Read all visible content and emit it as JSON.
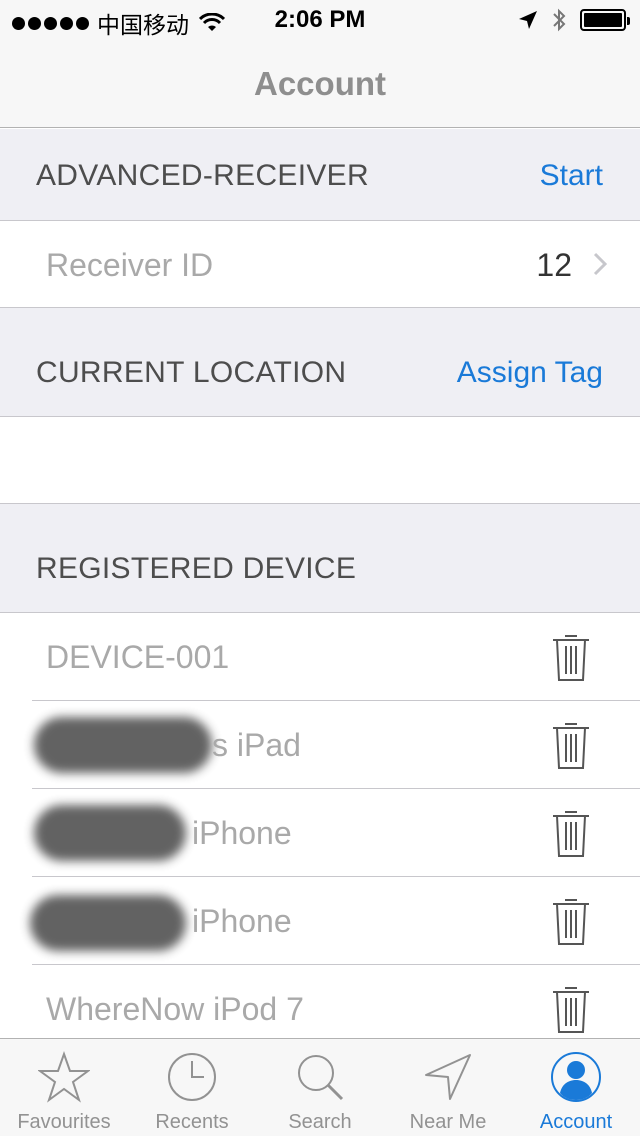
{
  "status_bar": {
    "carrier": "中国移动",
    "time": "2:06 PM"
  },
  "nav": {
    "title": "Account"
  },
  "sections": {
    "advanced_receiver": {
      "title": "ADVANCED-RECEIVER",
      "action": "Start"
    },
    "receiver_id": {
      "label": "Receiver ID",
      "value": "12"
    },
    "current_location": {
      "title": "CURRENT LOCATION",
      "action": "Assign Tag"
    },
    "registered_device": {
      "title": "REGISTERED DEVICE"
    }
  },
  "devices": [
    {
      "name": "DEVICE-001",
      "redacted": false
    },
    {
      "name": "s iPad",
      "redacted": true
    },
    {
      "name": "iPhone",
      "redacted": true
    },
    {
      "name": "iPhone",
      "redacted": true
    },
    {
      "name": "WhereNow iPod 7",
      "redacted": false
    }
  ],
  "tabs": [
    {
      "label": "Favourites",
      "icon": "star-icon",
      "active": false
    },
    {
      "label": "Recents",
      "icon": "clock-icon",
      "active": false
    },
    {
      "label": "Search",
      "icon": "search-icon",
      "active": false
    },
    {
      "label": "Near Me",
      "icon": "location-arrow-icon",
      "active": false
    },
    {
      "label": "Account",
      "icon": "account-icon",
      "active": true
    }
  ],
  "colors": {
    "accent": "#1a7ad8",
    "section_background": "#efeff4",
    "bar_background": "#f7f7f7"
  }
}
